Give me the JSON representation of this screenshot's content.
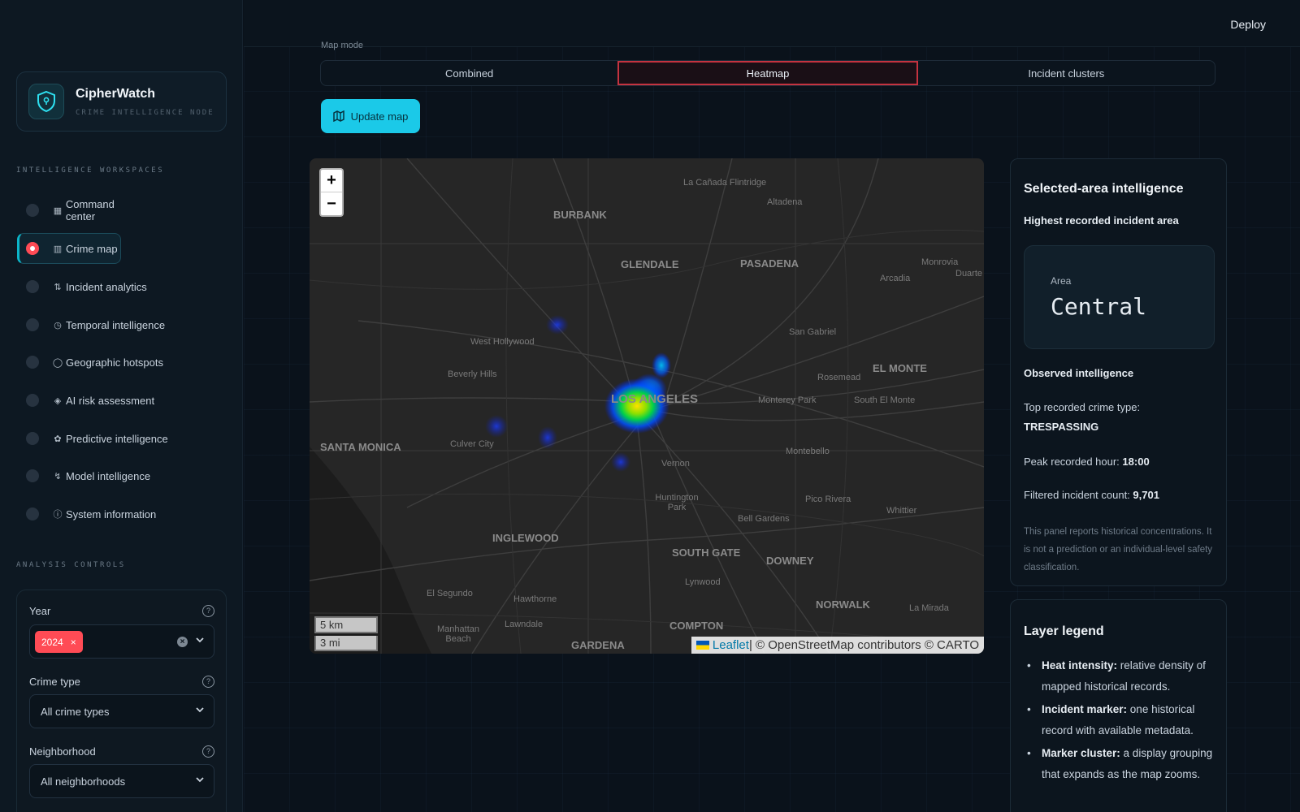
{
  "topbar": {
    "deploy_label": "Deploy"
  },
  "brand": {
    "name": "CipherWatch",
    "subtitle": "CRIME INTELLIGENCE NODE",
    "logo_icon": "shield-icon"
  },
  "sidebar": {
    "workspaces_label": "INTELLIGENCE WORKSPACES",
    "items": [
      {
        "label": "Command center",
        "icon": "dashboard-icon",
        "active": false
      },
      {
        "label": "Crime map",
        "icon": "map-icon",
        "active": true
      },
      {
        "label": "Incident analytics",
        "icon": "chart-icon",
        "active": false
      },
      {
        "label": "Temporal intelligence",
        "icon": "clock-icon",
        "active": false
      },
      {
        "label": "Geographic hotspots",
        "icon": "globe-icon",
        "active": false
      },
      {
        "label": "AI risk assessment",
        "icon": "shield-check-icon",
        "active": false
      },
      {
        "label": "Predictive intelligence",
        "icon": "brain-icon",
        "active": false
      },
      {
        "label": "Model intelligence",
        "icon": "model-icon",
        "active": false
      },
      {
        "label": "System information",
        "icon": "info-icon",
        "active": false
      }
    ],
    "controls_label": "ANALYSIS CONTROLS",
    "year": {
      "label": "Year",
      "selected_tag": "2024"
    },
    "crime_type": {
      "label": "Crime type",
      "value": "All crime types"
    },
    "neighborhood": {
      "label": "Neighborhood",
      "value": "All neighborhoods"
    }
  },
  "map_mode": {
    "label": "Map mode",
    "options": [
      "Combined",
      "Heatmap",
      "Incident clusters"
    ],
    "selected": "Heatmap"
  },
  "update_button": {
    "label": "Update map"
  },
  "map": {
    "zoom_in": "+",
    "zoom_out": "−",
    "scale_km": "5 km",
    "scale_mi": "3 mi",
    "attribution_link": "Leaflet",
    "attribution_rest": " | © OpenStreetMap contributors © CARTO",
    "places": [
      "BURBANK",
      "La Cañada Flintridge",
      "Altadena",
      "GLENDALE",
      "PASADENA",
      "Monrovia",
      "Duarte",
      "Arcadia",
      "West Hollywood",
      "San Gabriel",
      "Beverly Hills",
      "EL MONTE",
      "Rosemead",
      "LOS ANGELES",
      "Monterey Park",
      "South El Monte",
      "SANTA MONICA",
      "Culver City",
      "Vernon",
      "Montebello",
      "Huntington Park",
      "Pico Rivera",
      "Whittier",
      "Bell Gardens",
      "INGLEWOOD",
      "SOUTH GATE",
      "DOWNEY",
      "Lynwood",
      "El Segundo",
      "Hawthorne",
      "NORWALK",
      "La Mirada",
      "Manhattan Beach",
      "Lawndale",
      "COMPTON",
      "GARDENA"
    ]
  },
  "selected_area": {
    "title": "Selected-area intelligence",
    "subtitle": "Highest recorded incident area",
    "area_label": "Area",
    "area_value": "Central",
    "observed_label": "Observed intelligence",
    "top_crime_label": "Top recorded crime type:",
    "top_crime_value": "TRESPASSING",
    "peak_hour_label": "Peak recorded hour:",
    "peak_hour_value": "18:00",
    "count_label": "Filtered incident count:",
    "count_value": "9,701",
    "note": "This panel reports historical concentrations. It is not a prediction or an individual-level safety classification."
  },
  "legend": {
    "title": "Layer legend",
    "items": [
      {
        "term": "Heat intensity:",
        "desc": " relative density of mapped historical records."
      },
      {
        "term": "Incident marker:",
        "desc": " one historical record with available metadata."
      },
      {
        "term": "Marker cluster:",
        "desc": " a display grouping that expands as the map zooms."
      }
    ]
  },
  "colors": {
    "accent": "#1bc9e8",
    "danger": "#ff4b55",
    "background": "#0a121b"
  }
}
